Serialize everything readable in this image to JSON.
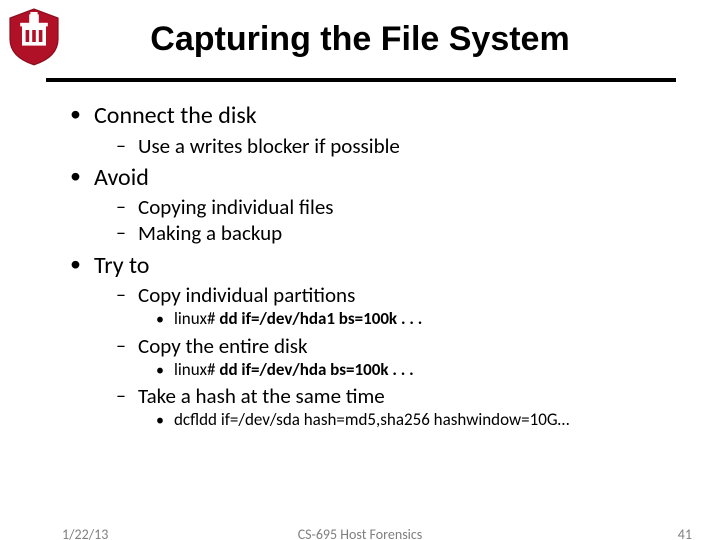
{
  "title": "Capturing the File System",
  "bullets": {
    "b1": "Connect the disk",
    "b1_1": "Use a writes blocker if possible",
    "b2": "Avoid",
    "b2_1": "Copying individual files",
    "b2_2": "Making a backup",
    "b3": "Try to",
    "b3_1": "Copy individual partitions",
    "b3_1_1_prompt": "linux# ",
    "b3_1_1_cmd": "dd if=/dev/hda1 bs=100k . . .",
    "b3_2": "Copy the entire disk",
    "b3_2_1_prompt": "linux# ",
    "b3_2_1_cmd": "dd if=/dev/hda bs=100k . . .",
    "b3_3": "Take a hash at the same time",
    "b3_3_1": "dcfldd if=/dev/sda hash=md5,sha256 hashwindow=10G…"
  },
  "footer": {
    "date": "1/22/13",
    "center": "CS-695 Host Forensics",
    "page": "41"
  }
}
